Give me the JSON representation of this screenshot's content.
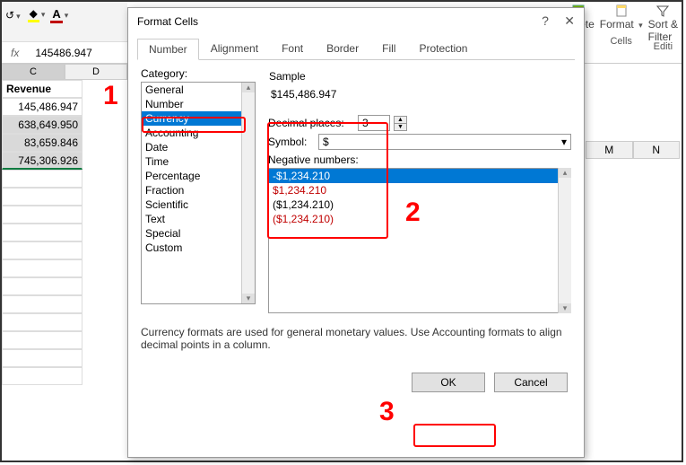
{
  "ribbon": {
    "format_label": "Format",
    "delete_label": "Delete",
    "sort_filter_label": "Sort &\nFilter",
    "cells_group": "Cells",
    "editing_group": "Editi"
  },
  "formula_bar": {
    "fx_label": "fx",
    "value": "145486.947"
  },
  "sheet": {
    "columns": [
      "C",
      "D"
    ],
    "right_columns": [
      "M",
      "N"
    ],
    "rows": [
      {
        "c": "Revenue",
        "is_header": true
      },
      {
        "c": "145,486.947",
        "selected": true
      },
      {
        "c": "638,649.950",
        "selected": true
      },
      {
        "c": "83,659.846",
        "selected": true
      },
      {
        "c": "745,306.926",
        "selected": true
      }
    ]
  },
  "dialog": {
    "title": "Format Cells",
    "help": "?",
    "close": "✕",
    "tabs": [
      "Number",
      "Alignment",
      "Font",
      "Border",
      "Fill",
      "Protection"
    ],
    "active_tab": 0,
    "category_label": "Category:",
    "categories": [
      "General",
      "Number",
      "Currency",
      "Accounting",
      "Date",
      "Time",
      "Percentage",
      "Fraction",
      "Scientific",
      "Text",
      "Special",
      "Custom"
    ],
    "selected_category_index": 2,
    "sample_label": "Sample",
    "sample_value": "$145,486.947",
    "decimal_label": "Decimal places:",
    "decimal_value": "3",
    "symbol_label": "Symbol:",
    "symbol_value": "$",
    "negative_label": "Negative numbers:",
    "negative_options": [
      {
        "text": "-$1,234.210",
        "red": false,
        "selected": true
      },
      {
        "text": "$1,234.210",
        "red": true,
        "selected": false
      },
      {
        "text": "($1,234.210)",
        "red": false,
        "selected": false
      },
      {
        "text": "($1,234.210)",
        "red": true,
        "selected": false
      }
    ],
    "description": "Currency formats are used for general monetary values.  Use Accounting formats to align decimal points in a column.",
    "ok_label": "OK",
    "cancel_label": "Cancel"
  },
  "annotations": {
    "n1": "1",
    "n2": "2",
    "n3": "3"
  }
}
